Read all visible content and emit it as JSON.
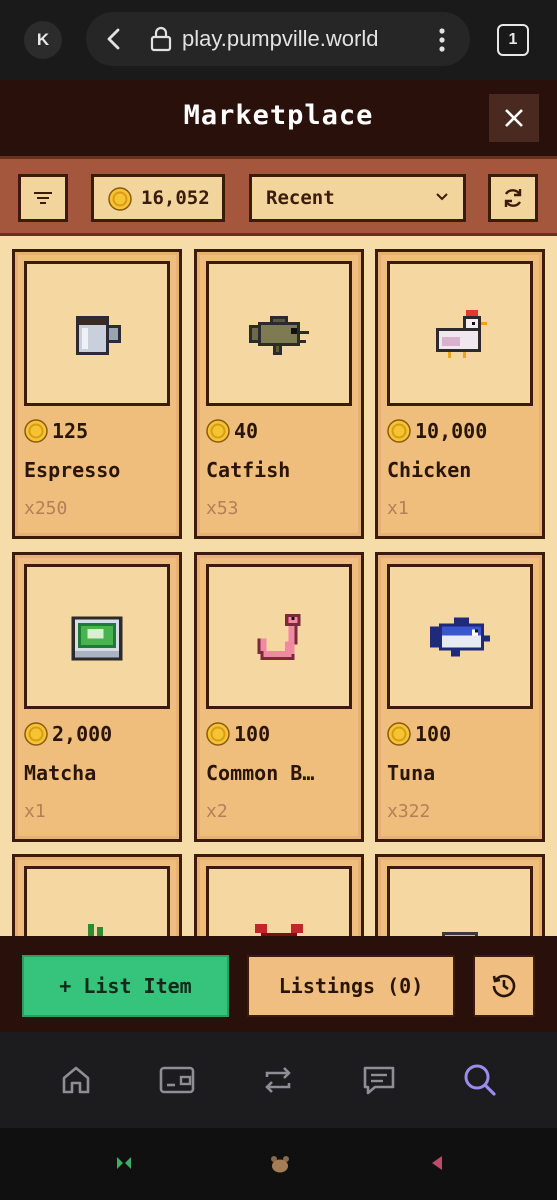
{
  "browser": {
    "avatar_letter": "K",
    "url": "play.pumpville.world",
    "tab_count": "1"
  },
  "modal": {
    "title": "Marketplace",
    "close_icon": "close-icon"
  },
  "toolbar": {
    "filter_icon": "filter-icon",
    "coin_balance": "16,052",
    "sort_value": "Recent",
    "refresh_icon": "refresh-icon"
  },
  "items": [
    {
      "icon": "espresso-icon",
      "price": "125",
      "name": "Espresso",
      "qty": "x250"
    },
    {
      "icon": "catfish-icon",
      "price": "40",
      "name": "Catfish",
      "qty": "x53"
    },
    {
      "icon": "chicken-icon",
      "price": "10,000",
      "name": "Chicken",
      "qty": "x1"
    },
    {
      "icon": "matcha-icon",
      "price": "2,000",
      "name": "Matcha",
      "qty": "x1"
    },
    {
      "icon": "worm-icon",
      "price": "100",
      "name": "Common B…",
      "qty": "x2"
    },
    {
      "icon": "tuna-icon",
      "price": "100",
      "name": "Tuna",
      "qty": "x322"
    },
    {
      "icon": "carrot-icon",
      "price": "",
      "name": "",
      "qty": ""
    },
    {
      "icon": "crab-icon",
      "price": "",
      "name": "",
      "qty": ""
    },
    {
      "icon": "rock-icon",
      "price": "",
      "name": "",
      "qty": ""
    }
  ],
  "actions": {
    "list_item_label": "+ List Item",
    "listings_label": "Listings (0)",
    "history_icon": "history-icon"
  },
  "app_nav": [
    "home-icon",
    "wallet-icon",
    "swap-icon",
    "chat-icon",
    "search-icon"
  ],
  "colors": {
    "accent_green": "#36c47c",
    "card_bg": "#efbe7d",
    "header_bg": "#2a100a",
    "active_nav": "#9b8cf0"
  }
}
